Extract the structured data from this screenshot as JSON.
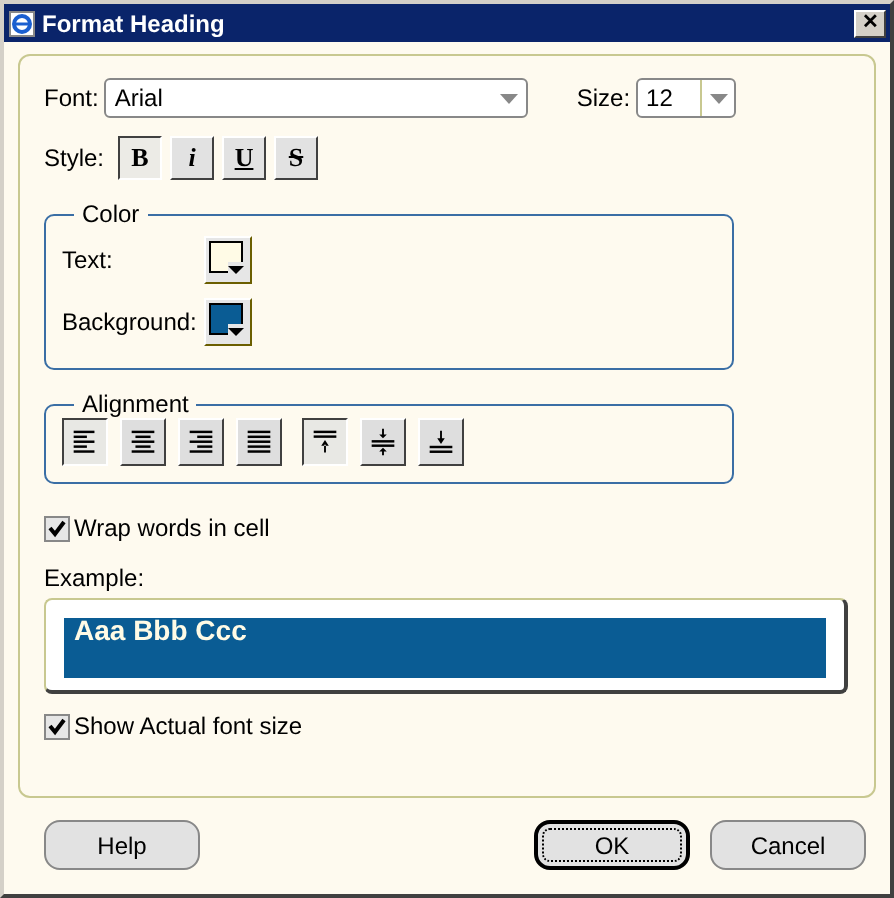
{
  "window": {
    "title": "Format Heading",
    "close": "✕"
  },
  "font": {
    "label": "Font:",
    "value": "Arial"
  },
  "size": {
    "label": "Size:",
    "value": "12"
  },
  "style": {
    "label": "Style:",
    "buttons": [
      {
        "kind": "bold",
        "text": "B",
        "selected": true
      },
      {
        "kind": "italic",
        "text": "i",
        "selected": false
      },
      {
        "kind": "underline",
        "text": "U",
        "selected": false
      },
      {
        "kind": "strike",
        "text": "S",
        "selected": false
      }
    ]
  },
  "color": {
    "title": "Color",
    "items": [
      {
        "label": "Text:",
        "color": "#fffbe6"
      },
      {
        "label": "Background:",
        "color": "#0a5c94"
      }
    ]
  },
  "alignment": {
    "title": "Alignment",
    "buttons": [
      {
        "kind": "left",
        "selected": true
      },
      {
        "kind": "center",
        "selected": false
      },
      {
        "kind": "right",
        "selected": false
      },
      {
        "kind": "justify",
        "selected": false
      },
      {
        "kind": "top",
        "selected": true
      },
      {
        "kind": "middle",
        "selected": false
      },
      {
        "kind": "bottom",
        "selected": false
      }
    ]
  },
  "wrap": {
    "label": "Wrap words in cell",
    "checked": true
  },
  "example": {
    "label": "Example:",
    "text": "Aaa Bbb Ccc"
  },
  "actual": {
    "label": "Show Actual font size",
    "checked": true
  },
  "buttons": [
    {
      "label": "Help",
      "default": false
    },
    {
      "label": "OK",
      "default": true
    },
    {
      "label": "Cancel",
      "default": false
    }
  ]
}
